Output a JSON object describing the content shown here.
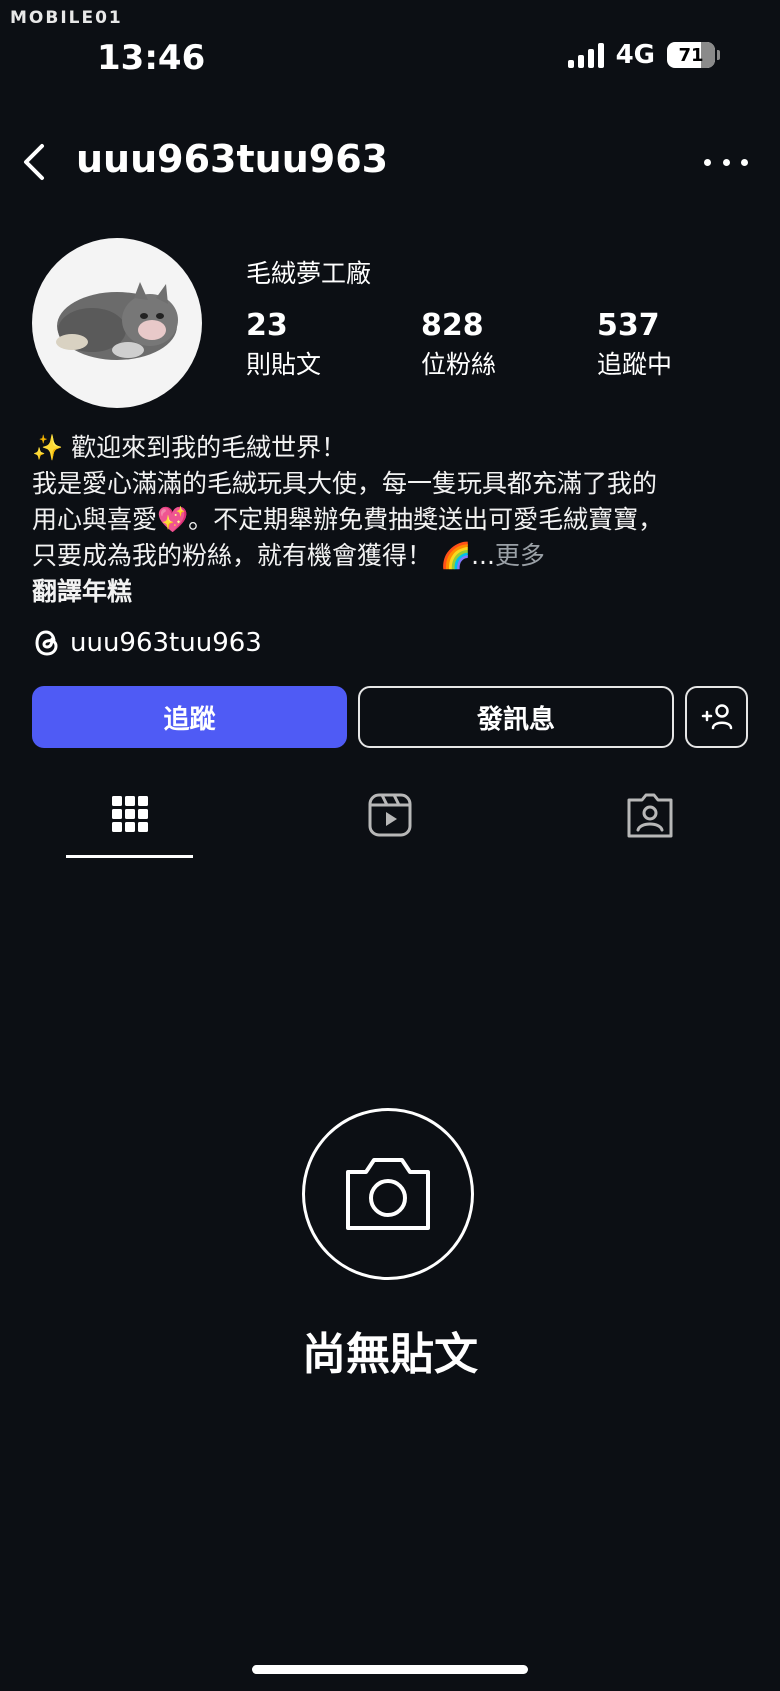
{
  "watermark": "MOBILE01",
  "status_bar": {
    "time": "13:46",
    "network": "4G",
    "battery": "71"
  },
  "header": {
    "username": "uuu963tuu963"
  },
  "profile": {
    "display_name": "毛絨夢工廠",
    "stats": [
      {
        "value": "23",
        "label": "則貼文"
      },
      {
        "value": "828",
        "label": "位粉絲"
      },
      {
        "value": "537",
        "label": "追蹤中"
      }
    ],
    "bio": {
      "line1": "✨ 歡迎來到我的毛絨世界！",
      "line2": "我是愛心滿滿的毛絨玩具大使，每一隻玩具都充滿了我的",
      "line3": "用心與喜愛💖。不定期舉辦免費抽獎送出可愛毛絨寶寶，",
      "line4": "只要成為我的粉絲，就有機會獲得！ 🌈...",
      "more": "更多",
      "translate": "翻譯年糕"
    },
    "threads_handle": "uuu963tuu963"
  },
  "actions": {
    "follow": "追蹤",
    "message": "發訊息"
  },
  "empty_state": {
    "text": "尚無貼文"
  },
  "icons": [
    "back-icon",
    "more-icon",
    "threads-icon",
    "add-person-icon",
    "grid-icon",
    "reels-icon",
    "tagged-icon",
    "camera-icon"
  ],
  "colors": {
    "background": "#0c0f14",
    "follow_button": "#4f5bf5"
  }
}
